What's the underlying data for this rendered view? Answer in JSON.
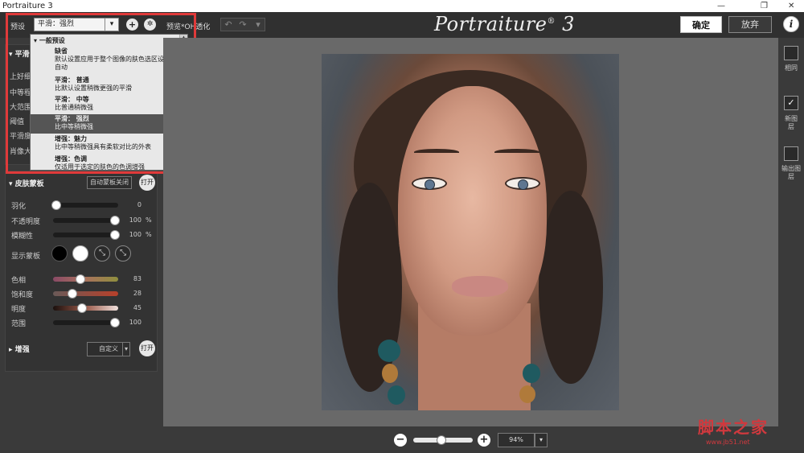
{
  "window": {
    "title": "Portraiture 3",
    "controls": [
      "—",
      "❐",
      "✕"
    ]
  },
  "toolbar": {
    "preset_label": "预设",
    "preset_value": "平滑：强烈",
    "preview_label": "预览*OH透化",
    "logo": "Portraiture",
    "logo_mark": "®",
    "logo_version": "3",
    "ok_label": "确定",
    "cancel_label": "放弃",
    "info_label": "i"
  },
  "dropdown": {
    "group_label": "一般预设",
    "items": [
      {
        "title": "缺省",
        "desc": "默认设置应用于整个图像的肤色选区设置为自动",
        "selected": false
      },
      {
        "title": "平滑： 普通",
        "desc": "比默认设置稍微更强的平滑",
        "selected": false
      },
      {
        "title": "平滑： 中等",
        "desc": "比普通稍微强",
        "selected": false
      },
      {
        "title": "平滑： 强烈",
        "desc": "比中等稍微强",
        "selected": true
      },
      {
        "title": "增强：魅力",
        "desc": "比中等稍微强具有柔软对比的外表",
        "selected": false
      },
      {
        "title": "增强：色调",
        "desc": "仅适用于选定的肤色的色调增强",
        "selected": false
      }
    ]
  },
  "hidden_rows": {
    "head": "平滑",
    "labels": [
      "上好细",
      "中等程",
      "大范围",
      "阈值",
      "平滑度",
      "肖像大"
    ]
  },
  "skin_mask": {
    "title": "皮肤蒙板",
    "auto_btn": "自动蒙板关闭",
    "open_btn": "打开",
    "show_mask_label": "显示蒙板",
    "sliders": [
      {
        "label": "羽化",
        "value": "0",
        "unit": "",
        "pos": 0.0
      },
      {
        "label": "不透明度",
        "value": "100",
        "unit": "%",
        "pos": 1.0
      },
      {
        "label": "模糊性",
        "value": "100",
        "unit": "%",
        "pos": 1.0
      }
    ],
    "color_sliders": [
      {
        "label": "色相",
        "value": "83",
        "pos": 0.42
      },
      {
        "label": "饱和度",
        "value": "28",
        "pos": 0.3
      },
      {
        "label": "明度",
        "value": "45",
        "pos": 0.45
      },
      {
        "label": "范围",
        "value": "100",
        "pos": 1.0
      }
    ]
  },
  "enhance": {
    "title": "增强",
    "select_value": "自定义",
    "open_btn": "打开"
  },
  "rightbar": {
    "items": [
      "相同",
      "新图层",
      "输出图层"
    ]
  },
  "zoom": {
    "value": "94%",
    "minus": "−",
    "plus": "+",
    "pos": 0.47
  },
  "watermark": {
    "text": "脚本之家",
    "url": "www.jb51.net"
  },
  "colors": {
    "accent_red": "#e03a3a",
    "panel": "#3a3a3a",
    "canvas": "#696969"
  }
}
